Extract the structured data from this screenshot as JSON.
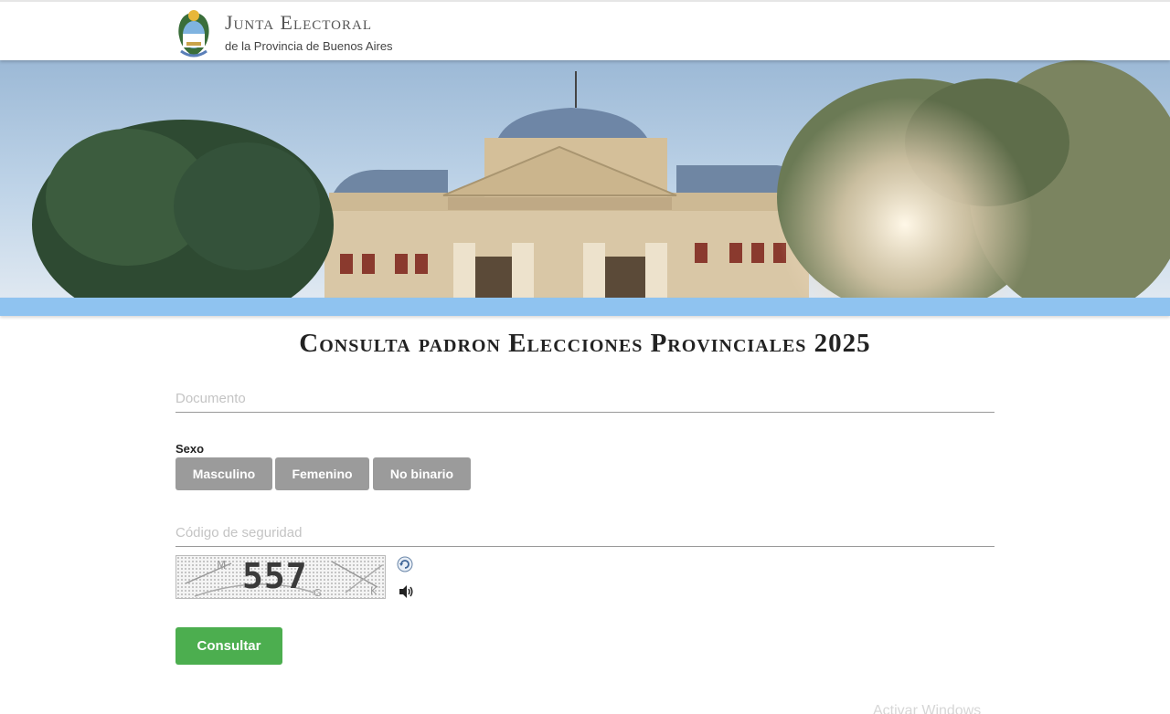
{
  "header": {
    "title": "Junta Electoral",
    "subtitle": "de la Provincia de Buenos Aires",
    "logo_icon": "coat-of-arms-icon"
  },
  "main": {
    "title": "Consulta padron Elecciones Provinciales 2025",
    "documento": {
      "placeholder": "Documento",
      "value": ""
    },
    "sexo": {
      "label": "Sexo",
      "options": [
        "Masculino",
        "Femenino",
        "No binario"
      ]
    },
    "codigo": {
      "placeholder": "Código de seguridad",
      "value": ""
    },
    "captcha": {
      "text": "557",
      "refresh_icon": "refresh-icon",
      "audio_icon": "speaker-icon"
    },
    "submit_label": "Consultar"
  },
  "colors": {
    "option_button": "#9b9b9b",
    "submit_button": "#4cae4f",
    "banner_strip": "#8fc3f0"
  },
  "watermark": "Activar Windows"
}
